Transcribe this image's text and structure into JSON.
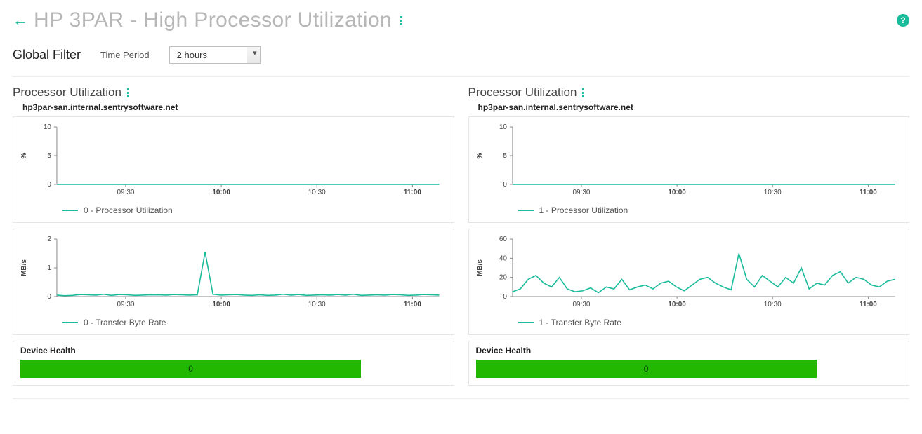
{
  "colors": {
    "line": "#1bbc9b",
    "health": "#22b700"
  },
  "header": {
    "title": "HP 3PAR - High Processor Utilization"
  },
  "filter": {
    "title": "Global Filter",
    "time_period_label": "Time Period",
    "time_period_value": "2 hours"
  },
  "panels": [
    {
      "title": "Processor Utilization",
      "subtitle": "hp3par-san.internal.sentrysoftware.net",
      "charts": [
        {
          "ylabel": "%",
          "legend": "0 - Processor Utilization",
          "y_ticks": [
            0,
            5,
            10
          ],
          "x_ticks": [
            {
              "v": 0.18,
              "label": "09:30",
              "bold": false
            },
            {
              "v": 0.43,
              "label": "10:00",
              "bold": true
            },
            {
              "v": 0.68,
              "label": "10:30",
              "bold": false
            },
            {
              "v": 0.93,
              "label": "11:00",
              "bold": true
            }
          ],
          "series": [
            {
              "name": "0 - Processor Utilization",
              "values": [
                0,
                0,
                0,
                0,
                0,
                0,
                0,
                0,
                0,
                0,
                0,
                0,
                0,
                0,
                0,
                0,
                0,
                0,
                0,
                0,
                0,
                0,
                0,
                0,
                0,
                0,
                0,
                0,
                0,
                0,
                0,
                0,
                0,
                0,
                0,
                0,
                0,
                0,
                0,
                0,
                0,
                0,
                0,
                0,
                0,
                0,
                0,
                0,
                0,
                0
              ]
            }
          ],
          "ylim": [
            0,
            10
          ]
        },
        {
          "ylabel": "MB/s",
          "legend": "0 - Transfer Byte Rate",
          "y_ticks": [
            0,
            1,
            2
          ],
          "x_ticks": [
            {
              "v": 0.18,
              "label": "09:30",
              "bold": false
            },
            {
              "v": 0.43,
              "label": "10:00",
              "bold": true
            },
            {
              "v": 0.68,
              "label": "10:30",
              "bold": false
            },
            {
              "v": 0.93,
              "label": "11:00",
              "bold": true
            }
          ],
          "series": [
            {
              "name": "0 - Transfer Byte Rate",
              "values": [
                0.05,
                0.03,
                0.04,
                0.07,
                0.06,
                0.05,
                0.08,
                0.04,
                0.07,
                0.06,
                0.04,
                0.05,
                0.06,
                0.06,
                0.05,
                0.07,
                0.06,
                0.05,
                0.06,
                1.55,
                0.08,
                0.05,
                0.06,
                0.07,
                0.05,
                0.04,
                0.06,
                0.04,
                0.05,
                0.08,
                0.05,
                0.07,
                0.04,
                0.05,
                0.06,
                0.05,
                0.07,
                0.05,
                0.08,
                0.04,
                0.05,
                0.06,
                0.05,
                0.07,
                0.06,
                0.04,
                0.05,
                0.07,
                0.06,
                0.05
              ]
            }
          ],
          "ylim": [
            0,
            2
          ]
        }
      ],
      "health": {
        "title": "Device Health",
        "value": "0",
        "max": 1
      }
    },
    {
      "title": "Processor Utilization",
      "subtitle": "hp3par-san.internal.sentrysoftware.net",
      "charts": [
        {
          "ylabel": "%",
          "legend": "1 - Processor Utilization",
          "y_ticks": [
            0,
            5,
            10
          ],
          "x_ticks": [
            {
              "v": 0.18,
              "label": "09:30",
              "bold": false
            },
            {
              "v": 0.43,
              "label": "10:00",
              "bold": true
            },
            {
              "v": 0.68,
              "label": "10:30",
              "bold": false
            },
            {
              "v": 0.93,
              "label": "11:00",
              "bold": true
            }
          ],
          "series": [
            {
              "name": "1 - Processor Utilization",
              "values": [
                0,
                0,
                0,
                0,
                0,
                0,
                0,
                0,
                0,
                0,
                0,
                0,
                0,
                0,
                0,
                0,
                0,
                0,
                0,
                0,
                0,
                0,
                0,
                0,
                0,
                0,
                0,
                0,
                0,
                0,
                0,
                0,
                0,
                0,
                0,
                0,
                0,
                0,
                0,
                0,
                0,
                0,
                0,
                0,
                0,
                0,
                0,
                0,
                0,
                0
              ]
            }
          ],
          "ylim": [
            0,
            10
          ]
        },
        {
          "ylabel": "MB/s",
          "legend": "1 - Transfer Byte Rate",
          "y_ticks": [
            0,
            20,
            40,
            60
          ],
          "x_ticks": [
            {
              "v": 0.18,
              "label": "09:30",
              "bold": false
            },
            {
              "v": 0.43,
              "label": "10:00",
              "bold": true
            },
            {
              "v": 0.68,
              "label": "10:30",
              "bold": false
            },
            {
              "v": 0.93,
              "label": "11:00",
              "bold": true
            }
          ],
          "series": [
            {
              "name": "1 - Transfer Byte Rate",
              "values": [
                5,
                8,
                18,
                22,
                14,
                10,
                20,
                8,
                5,
                6,
                9,
                4,
                10,
                8,
                18,
                7,
                10,
                12,
                8,
                14,
                16,
                10,
                6,
                12,
                18,
                20,
                14,
                10,
                7,
                45,
                18,
                10,
                22,
                16,
                10,
                20,
                14,
                30,
                8,
                14,
                12,
                22,
                26,
                14,
                20,
                18,
                12,
                10,
                16,
                18
              ]
            }
          ],
          "ylim": [
            0,
            60
          ]
        }
      ],
      "health": {
        "title": "Device Health",
        "value": "0",
        "max": 1
      }
    }
  ],
  "chart_data": [
    {
      "type": "line",
      "title": "Processor Utilization — 0",
      "host": "hp3par-san.internal.sentrysoftware.net",
      "xlabel": "",
      "ylabel": "%",
      "x_tick_labels": [
        "09:30",
        "10:00",
        "10:30",
        "11:00"
      ],
      "ylim": [
        0,
        10
      ],
      "series": [
        {
          "name": "0 - Processor Utilization",
          "values": [
            0,
            0,
            0,
            0,
            0,
            0,
            0,
            0,
            0,
            0,
            0,
            0,
            0,
            0,
            0,
            0,
            0,
            0,
            0,
            0,
            0,
            0,
            0,
            0,
            0,
            0,
            0,
            0,
            0,
            0,
            0,
            0,
            0,
            0,
            0,
            0,
            0,
            0,
            0,
            0,
            0,
            0,
            0,
            0,
            0,
            0,
            0,
            0,
            0,
            0
          ]
        }
      ]
    },
    {
      "type": "line",
      "title": "Transfer Byte Rate — 0",
      "host": "hp3par-san.internal.sentrysoftware.net",
      "xlabel": "",
      "ylabel": "MB/s",
      "x_tick_labels": [
        "09:30",
        "10:00",
        "10:30",
        "11:00"
      ],
      "ylim": [
        0,
        2
      ],
      "series": [
        {
          "name": "0 - Transfer Byte Rate",
          "values": [
            0.05,
            0.03,
            0.04,
            0.07,
            0.06,
            0.05,
            0.08,
            0.04,
            0.07,
            0.06,
            0.04,
            0.05,
            0.06,
            0.06,
            0.05,
            0.07,
            0.06,
            0.05,
            0.06,
            1.55,
            0.08,
            0.05,
            0.06,
            0.07,
            0.05,
            0.04,
            0.06,
            0.04,
            0.05,
            0.08,
            0.05,
            0.07,
            0.04,
            0.05,
            0.06,
            0.05,
            0.07,
            0.05,
            0.08,
            0.04,
            0.05,
            0.06,
            0.05,
            0.07,
            0.06,
            0.04,
            0.05,
            0.07,
            0.06,
            0.05
          ]
        }
      ]
    },
    {
      "type": "line",
      "title": "Processor Utilization — 1",
      "host": "hp3par-san.internal.sentrysoftware.net",
      "xlabel": "",
      "ylabel": "%",
      "x_tick_labels": [
        "09:30",
        "10:00",
        "10:30",
        "11:00"
      ],
      "ylim": [
        0,
        10
      ],
      "series": [
        {
          "name": "1 - Processor Utilization",
          "values": [
            0,
            0,
            0,
            0,
            0,
            0,
            0,
            0,
            0,
            0,
            0,
            0,
            0,
            0,
            0,
            0,
            0,
            0,
            0,
            0,
            0,
            0,
            0,
            0,
            0,
            0,
            0,
            0,
            0,
            0,
            0,
            0,
            0,
            0,
            0,
            0,
            0,
            0,
            0,
            0,
            0,
            0,
            0,
            0,
            0,
            0,
            0,
            0,
            0,
            0
          ]
        }
      ]
    },
    {
      "type": "line",
      "title": "Transfer Byte Rate — 1",
      "host": "hp3par-san.internal.sentrysoftware.net",
      "xlabel": "",
      "ylabel": "MB/s",
      "x_tick_labels": [
        "09:30",
        "10:00",
        "10:30",
        "11:00"
      ],
      "ylim": [
        0,
        60
      ],
      "series": [
        {
          "name": "1 - Transfer Byte Rate",
          "values": [
            5,
            8,
            18,
            22,
            14,
            10,
            20,
            8,
            5,
            6,
            9,
            4,
            10,
            8,
            18,
            7,
            10,
            12,
            8,
            14,
            16,
            10,
            6,
            12,
            18,
            20,
            14,
            10,
            7,
            45,
            18,
            10,
            22,
            16,
            10,
            20,
            14,
            30,
            8,
            14,
            12,
            22,
            26,
            14,
            20,
            18,
            12,
            10,
            16,
            18
          ]
        }
      ]
    }
  ]
}
